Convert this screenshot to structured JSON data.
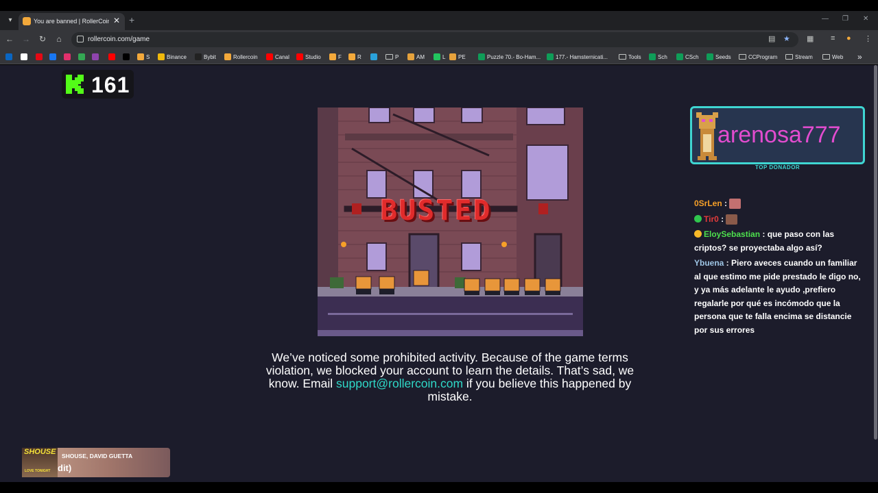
{
  "browser": {
    "tab_title": "You are banned | RollerCoin.com",
    "tab_close": "✕",
    "new_tab": "+",
    "url": "rollercoin.com/game",
    "menu_icon": "chevron-down-icon",
    "window_controls": [
      "—",
      "❐",
      "✕"
    ]
  },
  "bookmarks": [
    {
      "label": "",
      "icon_color": "#0a66c2"
    },
    {
      "label": "",
      "icon_color": "#ffffff"
    },
    {
      "label": "",
      "icon_color": "#e50914"
    },
    {
      "label": "",
      "icon_color": "#e1306c"
    },
    {
      "label": "",
      "icon_color": "#1877f2"
    },
    {
      "label": "",
      "icon_color": "#34a853"
    },
    {
      "label": "",
      "icon_color": "#8e44ad"
    },
    {
      "label": "",
      "icon_color": "#ff0000"
    },
    {
      "label": "",
      "icon_color": "#000000"
    },
    {
      "label": "S",
      "icon_color": "#f3a93b"
    },
    {
      "label": "Binance",
      "icon_color": "#f0b90b"
    },
    {
      "label": "Bybit",
      "icon_color": "#222222"
    },
    {
      "label": "Rollercoin",
      "icon_color": "#f3a93b"
    },
    {
      "label": "Canal",
      "icon_color": "#ff0000"
    },
    {
      "label": "Studio",
      "icon_color": "#ff0000"
    },
    {
      "label": "F",
      "icon_color": "#f3a93b"
    },
    {
      "label": "R",
      "icon_color": "#f3a93b"
    },
    {
      "label": "",
      "icon_color": "#2aa1da"
    },
    {
      "label": "P",
      "icon_color": "folder"
    },
    {
      "label": "AM",
      "icon_color": "#e6a23c"
    },
    {
      "label": "L",
      "icon_color": "#22c55e"
    },
    {
      "label": "PE",
      "icon_color": "#e6a23c"
    },
    {
      "label": "Puzzle 70.- Bo-Ham...",
      "icon_color": "#0f9d58"
    },
    {
      "label": "177.- Hamsternicati...",
      "icon_color": "#0f9d58"
    },
    {
      "label": "Tools",
      "icon_color": "folder"
    },
    {
      "label": "Sch",
      "icon_color": "#0f9d58"
    },
    {
      "label": "CSch",
      "icon_color": "#0f9d58"
    },
    {
      "label": "Seeds",
      "icon_color": "#0f9d58"
    },
    {
      "label": "CCProgram",
      "icon_color": "folder"
    },
    {
      "label": "Stream",
      "icon_color": "folder"
    },
    {
      "label": "Web",
      "icon_color": "folder"
    }
  ],
  "bookmarks_more": "»",
  "counter": {
    "value": "161"
  },
  "game": {
    "banner_text": "BUSTED",
    "message_before": "We’ve noticed some prohibited activity. Because of the game terms violation, we blocked your account to learn the details. That’s sad, we know. Email ",
    "support_email": "support@rollercoin.com",
    "message_after": " if you believe this happened by mistake."
  },
  "donor": {
    "name": "arenosa777",
    "label": "TOP DONADOR"
  },
  "chat": [
    {
      "user": "0SrLen",
      "user_color": "#f7a028",
      "text": "",
      "badge_color": "",
      "emote_color": "#c27070"
    },
    {
      "user": "Tir0",
      "user_color": "#e23b3b",
      "text": "",
      "badge_color": "#30c64e",
      "emote_color": "#8a5a4a"
    },
    {
      "user": "EloySebastian",
      "user_color": "#4de04d",
      "text": "que paso con las criptos? se proyectaba algo así?",
      "badge_color": "#f7b928",
      "emote_color": ""
    },
    {
      "user": "Ybuena",
      "user_color": "#9fc6e6",
      "text": "Piero aveces cuando un familiar al que estimo me pide prestado le digo no, y ya más adelante le ayudo ,prefiero regalarle por qué es incómodo que la persona que te falla encima se distancie por sus errores",
      "badge_color": "",
      "emote_color": ""
    }
  ],
  "chat_separator": " : ",
  "now_playing": {
    "art_title": "SHOUSE",
    "art_subtitle": "LOVE TONIGHT",
    "artist": "SHOUSE, DAVID GUETTA",
    "track": "dit)"
  }
}
